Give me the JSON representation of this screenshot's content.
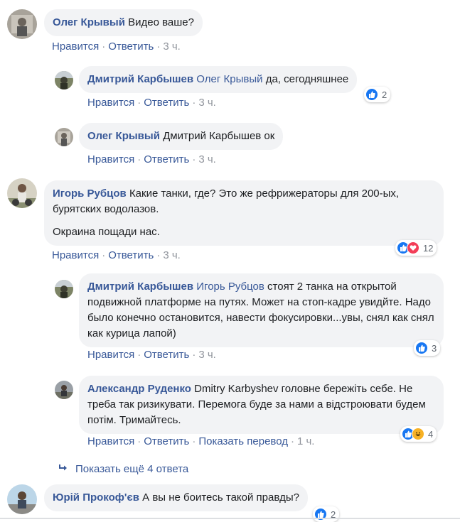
{
  "actions": {
    "like": "Нравится",
    "reply": "Ответить",
    "see_translation": "Показать перевод",
    "dot": "·"
  },
  "comments": [
    {
      "author": "Олег Крывый",
      "text": "Видео ваше?",
      "time": "3 ч."
    },
    {
      "author": "Дмитрий Карбышев",
      "mention": "Олег Крывый",
      "text": "да, сегодняшнее",
      "time": "3 ч.",
      "reaction_count": "2"
    },
    {
      "author": "Олег Крывый",
      "text": "Дмитрий Карбышев ок",
      "time": "3 ч."
    },
    {
      "author": "Игорь Рубцов",
      "text": "Какие танки, где? Это же рефрижераторы для 200-ых, бурятских водолазов.",
      "text2": "Окраина пощади нас.",
      "time": "3 ч.",
      "reaction_count": "12"
    },
    {
      "author": "Дмитрий Карбышев",
      "mention": "Игорь Рубцов",
      "text": "стоят 2 танка на открытой подвижной платформе на путях. Может на стоп-кадре увидйте. Надо было конечно остановится, навести фокусировки...увы, снял как снял как курица лапой)",
      "time": "3 ч.",
      "reaction_count": "3"
    },
    {
      "author": "Александр Руденко",
      "text": "Dmitry Karbyshev головне бережіть себе. Не треба так ризикувати. Перемога буде за нами а відстроювати будем потім. Тримайтесь.",
      "time": "1 ч.",
      "reaction_count": "4"
    },
    {
      "author": "Юрій Прокоф'єв",
      "text": "А вы не боитесь такой правды?",
      "reaction_count": "2"
    }
  ],
  "more_replies": "Показать ещё 4 ответа",
  "colors": {
    "link": "#385898",
    "bubble": "#f2f3f5",
    "muted": "#90949c",
    "like": "#1877f2",
    "love": "#f33e58",
    "haha": "#f7b125"
  }
}
